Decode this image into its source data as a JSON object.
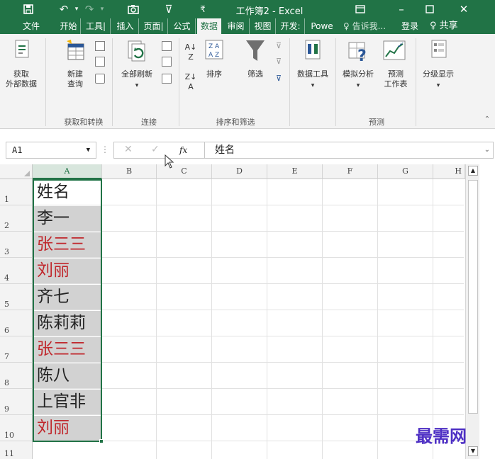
{
  "titlebar": {
    "title": "工作簿2 - Excel"
  },
  "tabs": [
    {
      "label": "文件"
    },
    {
      "label": "开始"
    },
    {
      "label": "工具|"
    },
    {
      "label": "插入"
    },
    {
      "label": "页面|"
    },
    {
      "label": "公式"
    },
    {
      "label": "数据"
    },
    {
      "label": "审阅"
    },
    {
      "label": "视图"
    },
    {
      "label": "开发:"
    },
    {
      "label": "Powe"
    }
  ],
  "tellme": "♀ 告诉我...",
  "login": "登录",
  "share": "♀ 共享",
  "ribbon": {
    "get_data": "获取\n外部数据",
    "new_query": "新建\n查询",
    "refresh_all": "全部刷新",
    "sort": "排序",
    "filter": "筛选",
    "data_tools": "数据工具",
    "what_if": "模拟分析",
    "forecast_sheet": "预测\n工作表",
    "outline": "分级显示",
    "groups": {
      "get_transform": "获取和转换",
      "connections": "连接",
      "sort_filter": "排序和筛选",
      "forecast": "预测"
    }
  },
  "formula_bar": {
    "name_box": "A1",
    "fx": "fx",
    "content": "姓名"
  },
  "columns": [
    "A",
    "B",
    "C",
    "D",
    "E",
    "F",
    "G",
    "H"
  ],
  "rows": [
    "1",
    "2",
    "3",
    "4",
    "5",
    "6",
    "7",
    "8",
    "9",
    "10",
    "11"
  ],
  "cells": [
    {
      "text": "姓名",
      "color": "#222222"
    },
    {
      "text": "李一",
      "color": "#222222"
    },
    {
      "text": "张三三",
      "color": "#c0282d"
    },
    {
      "text": "刘丽",
      "color": "#c0282d"
    },
    {
      "text": "齐七",
      "color": "#222222"
    },
    {
      "text": "陈莉莉",
      "color": "#222222"
    },
    {
      "text": "张三三",
      "color": "#c0282d"
    },
    {
      "text": "陈八",
      "color": "#222222"
    },
    {
      "text": "上官非",
      "color": "#222222"
    },
    {
      "text": "刘丽",
      "color": "#c0282d"
    }
  ],
  "watermark": "最需网",
  "colors": {
    "accent": "#217346",
    "duplicate": "#c0282d",
    "selection_fill": "#d2d2d2"
  }
}
